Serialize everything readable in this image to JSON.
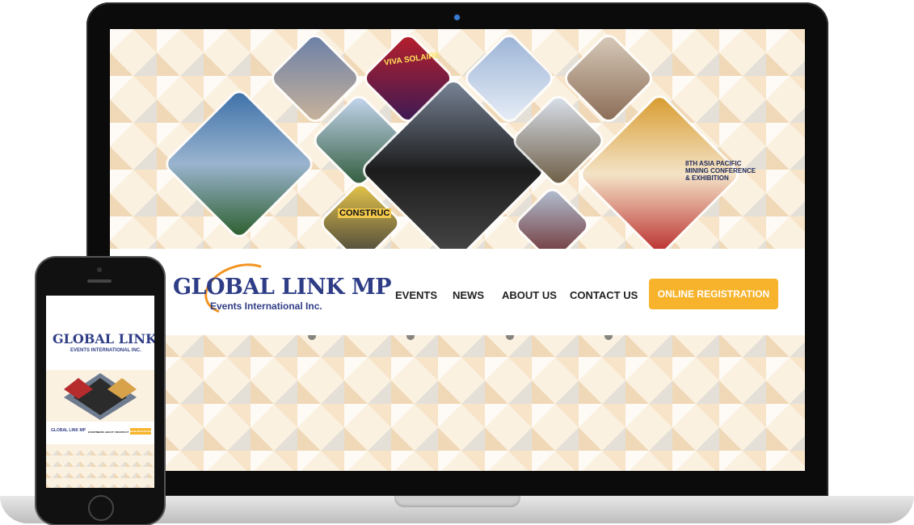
{
  "desktop": {
    "logo": {
      "main": "GLOBAL LINK MP",
      "sub": "Events International Inc."
    },
    "nav": [
      {
        "label": "EVENTS"
      },
      {
        "label": "NEWS"
      },
      {
        "label": "ABOUT US"
      },
      {
        "label": "CONTACT US"
      }
    ],
    "cta_label": "ONLINE REGISTRATION",
    "hero_text": {
      "sign1": "VIVA SOLAIRE",
      "sign2": "8TH ASIA PACIFIC MINING CONFERENCE & EXHIBITION",
      "sign3": "CONSTRUC"
    }
  },
  "mobile": {
    "logo": {
      "main": "GLOBAL LINK MP",
      "sub": "EVENTS INTERNATIONAL INC."
    },
    "header_logo": "GLOBAL LINK MP",
    "nav": [
      {
        "label": "EVENTS"
      },
      {
        "label": "NEWS"
      },
      {
        "label": "ABOUT US"
      },
      {
        "label": "CONTACT"
      }
    ],
    "cta_label": "ONLINE REGISTRATION"
  },
  "colors": {
    "brand_blue": "#2f3d86",
    "brand_orange": "#f29420",
    "cta_yellow": "#f7b32b"
  }
}
